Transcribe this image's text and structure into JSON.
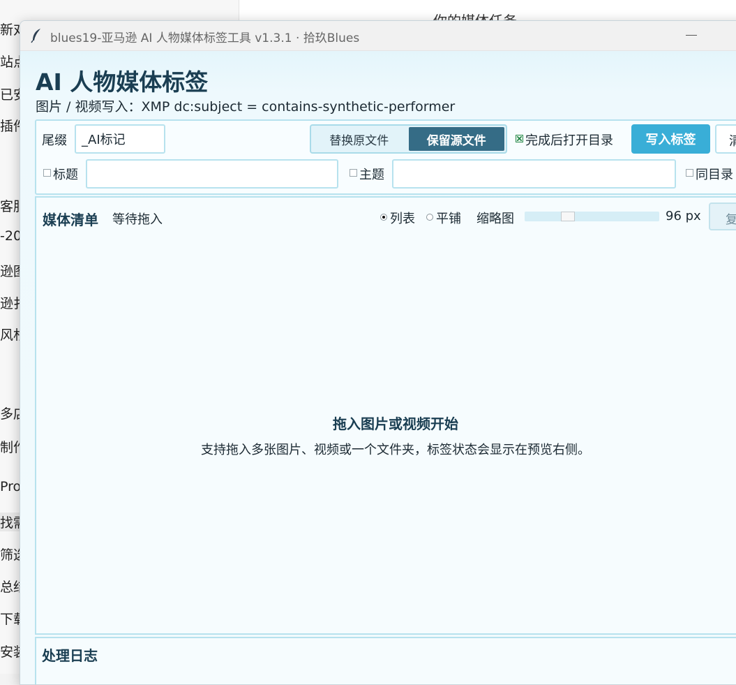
{
  "background_window": {
    "title_fragment": "你的媒体任务",
    "side_items": [
      "新对",
      "站点",
      "已安",
      "插件",
      "客服",
      "-20",
      "逊图",
      "逊扌",
      "风杉",
      "多店",
      "制作",
      "Proj",
      "找需",
      "筛选",
      "总结",
      "下载",
      "安装"
    ]
  },
  "window": {
    "title": "blues19-亚马逊 AI 人物媒体标签工具 v1.3.1 · 拾玖Blues",
    "minimize_glyph": "—"
  },
  "header": {
    "title": "AI 人物媒体标签",
    "subtitle": "图片 / 视频写入：XMP dc:subject = contains-synthetic-performer"
  },
  "options": {
    "suffix_label": "尾缀",
    "suffix_value": "_AI标记",
    "mode_options": [
      "替换原文件",
      "保留源文件"
    ],
    "mode_selected": "保留源文件",
    "open_dir_label": "完成后打开目录",
    "open_dir_checked": true,
    "write_button": "写入标签",
    "clear_button": "清",
    "title_label": "标题",
    "title_checked": false,
    "title_value": "",
    "subject_label": "主题",
    "subject_checked": false,
    "subject_value": "",
    "same_dir_label": "同目录"
  },
  "media": {
    "title": "媒体清单",
    "status": "等待拖入",
    "view_list_label": "列表",
    "view_tile_label": "平铺",
    "view_selected": "列表",
    "thumb_label": "缩略图",
    "thumb_value": "96 px",
    "thumb_fraction": 0.3,
    "copy_button": "复",
    "empty_title": "拖入图片或视频开始",
    "empty_desc": "支持拖入多张图片、视频或一个文件夹，标签状态会显示在预览右侧。"
  },
  "log": {
    "title": "处理日志"
  },
  "colors": {
    "accent": "#39aed7",
    "segment_active": "#356c86",
    "heading": "#1a3e52",
    "border": "#b7e2ee"
  },
  "icons": {
    "app_icon": "feather-icon",
    "open_dir_check": "checkbox-checked-icon"
  }
}
